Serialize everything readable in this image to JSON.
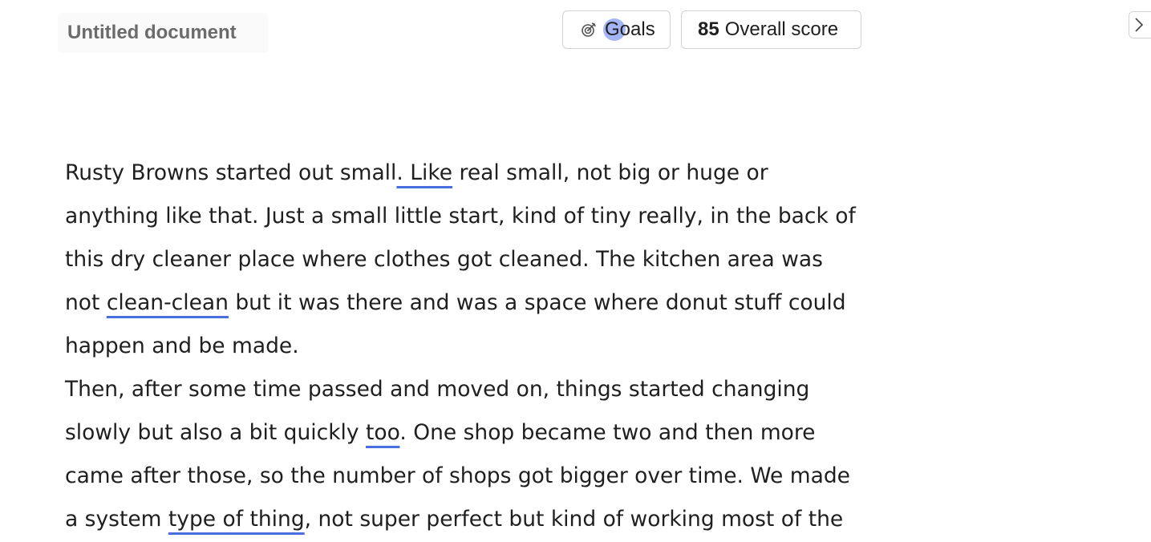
{
  "header": {
    "doc_title": "Untitled document",
    "goals_label": "Goals",
    "score_value": "85",
    "score_label": "Overall score"
  },
  "icons": {
    "goals": "target-icon",
    "sidebar_toggle": "chevron-right-icon"
  },
  "colors": {
    "suggestion_underline": "#4a6ee0",
    "cursor": "#5a78eb"
  },
  "document": {
    "paragraphs": [
      {
        "lines": [
          {
            "parts": [
              "Rusty Browns started out small",
              ". Like",
              " real small, not big or huge or"
            ]
          },
          {
            "parts": [
              "anything like that. Just a small little start, kind of tiny really, in the back of"
            ]
          },
          {
            "parts": [
              "this dry cleaner place where clothes got cleaned. The kitchen area was"
            ]
          },
          {
            "parts": [
              "not ",
              "clean-clean",
              " but it was there and was a space where donut stuff could"
            ]
          },
          {
            "parts": [
              "happen and be made."
            ]
          }
        ]
      },
      {
        "lines": [
          {
            "parts": [
              "Then, after some time passed and moved on, things started changing"
            ]
          },
          {
            "parts": [
              "slowly but also a bit quickly ",
              "too",
              ". One shop became two and then more"
            ]
          },
          {
            "parts": [
              "came after those, so the number of shops got bigger over time. We made"
            ]
          },
          {
            "parts": [
              "a system ",
              "type of thing",
              ", not super perfect but kind of working most of the"
            ]
          }
        ]
      }
    ]
  }
}
